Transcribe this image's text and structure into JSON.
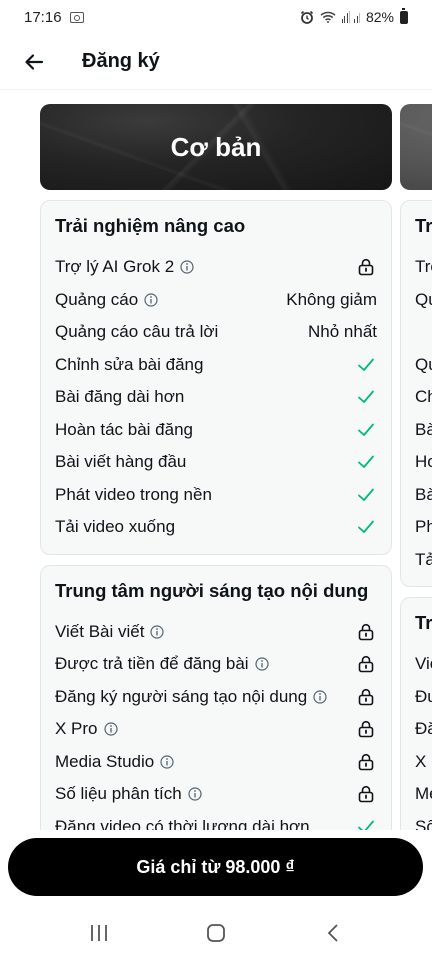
{
  "status": {
    "time": "17:16",
    "battery": "82%"
  },
  "header": {
    "title": "Đăng ký"
  },
  "plan": {
    "name": "Cơ bản"
  },
  "sections": [
    {
      "title": "Trải nghiệm nâng cao",
      "rows": [
        {
          "label": "Trợ lý AI Grok 2",
          "info": true,
          "value_type": "lock",
          "value": ""
        },
        {
          "label": "Quảng cáo",
          "info": true,
          "value_type": "text",
          "value": "Không giảm"
        },
        {
          "label": "Quảng cáo câu trả lời",
          "info": false,
          "value_type": "text",
          "value": "Nhỏ nhất"
        },
        {
          "label": "Chỉnh sửa bài đăng",
          "info": false,
          "value_type": "check",
          "value": ""
        },
        {
          "label": "Bài đăng dài hơn",
          "info": false,
          "value_type": "check",
          "value": ""
        },
        {
          "label": "Hoàn tác bài đăng",
          "info": false,
          "value_type": "check",
          "value": ""
        },
        {
          "label": "Bài viết hàng đầu",
          "info": false,
          "value_type": "check",
          "value": ""
        },
        {
          "label": "Phát video trong nền",
          "info": false,
          "value_type": "check",
          "value": ""
        },
        {
          "label": "Tải video xuống",
          "info": false,
          "value_type": "check",
          "value": ""
        }
      ]
    },
    {
      "title": "Trung tâm người sáng tạo nội dung",
      "rows": [
        {
          "label": "Viết Bài viết",
          "info": true,
          "value_type": "lock",
          "value": ""
        },
        {
          "label": "Được trả tiền để đăng bài",
          "info": true,
          "value_type": "lock",
          "value": ""
        },
        {
          "label": "Đăng ký người sáng tạo nội dung",
          "info": true,
          "value_type": "lock",
          "value": ""
        },
        {
          "label": "X Pro",
          "info": true,
          "value_type": "lock",
          "value": ""
        },
        {
          "label": "Media Studio",
          "info": true,
          "value_type": "lock",
          "value": ""
        },
        {
          "label": "Số liệu phân tích",
          "info": true,
          "value_type": "lock",
          "value": ""
        },
        {
          "label": "Đăng video có thời lượng dài hơn",
          "info": false,
          "value_type": "check",
          "value": ""
        }
      ]
    }
  ],
  "next_plan": {
    "section1_title": "Tr",
    "section1_rows": [
      "Trợ",
      "Qu",
      "",
      "Qu",
      "Ch",
      "Bà",
      "Ho",
      "Bà",
      "Ph",
      "Tả"
    ],
    "section2_title": "Tr",
    "section2_rows": [
      "Viế",
      "Đư",
      "Đă",
      "X P",
      "Me",
      "Số"
    ]
  },
  "cta": {
    "label": "Giá chỉ từ 98.000 ₫"
  },
  "colors": {
    "check": "#00ba7c",
    "accent": "#000000"
  }
}
